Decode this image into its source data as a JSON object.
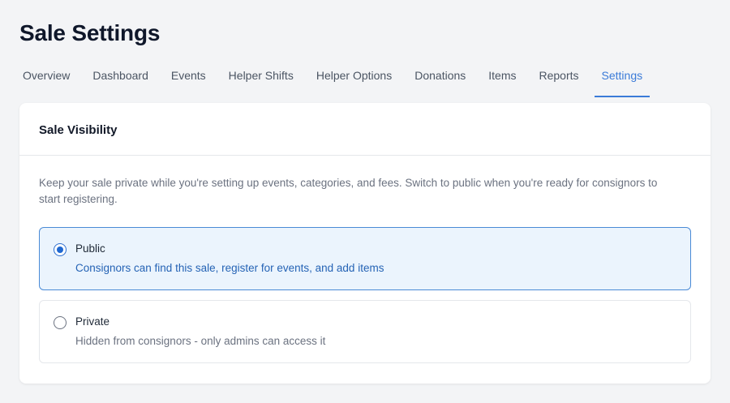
{
  "page": {
    "title": "Sale Settings"
  },
  "tabs": [
    {
      "label": "Overview",
      "active": false
    },
    {
      "label": "Dashboard",
      "active": false
    },
    {
      "label": "Events",
      "active": false
    },
    {
      "label": "Helper Shifts",
      "active": false
    },
    {
      "label": "Helper Options",
      "active": false
    },
    {
      "label": "Donations",
      "active": false
    },
    {
      "label": "Items",
      "active": false
    },
    {
      "label": "Reports",
      "active": false
    },
    {
      "label": "Settings",
      "active": true
    }
  ],
  "visibility": {
    "title": "Sale Visibility",
    "description": "Keep your sale private while you're setting up events, categories, and fees. Switch to public when you're ready for consignors to start registering.",
    "options": [
      {
        "label": "Public",
        "description": "Consignors can find this sale, register for events, and add items",
        "selected": true
      },
      {
        "label": "Private",
        "description": "Hidden from consignors - only admins can access it",
        "selected": false
      }
    ]
  },
  "colors": {
    "accent": "#3b7bd8",
    "selected_bg": "#ebf4fd",
    "selected_border": "#4a8ad6",
    "page_bg": "#f3f4f6"
  }
}
